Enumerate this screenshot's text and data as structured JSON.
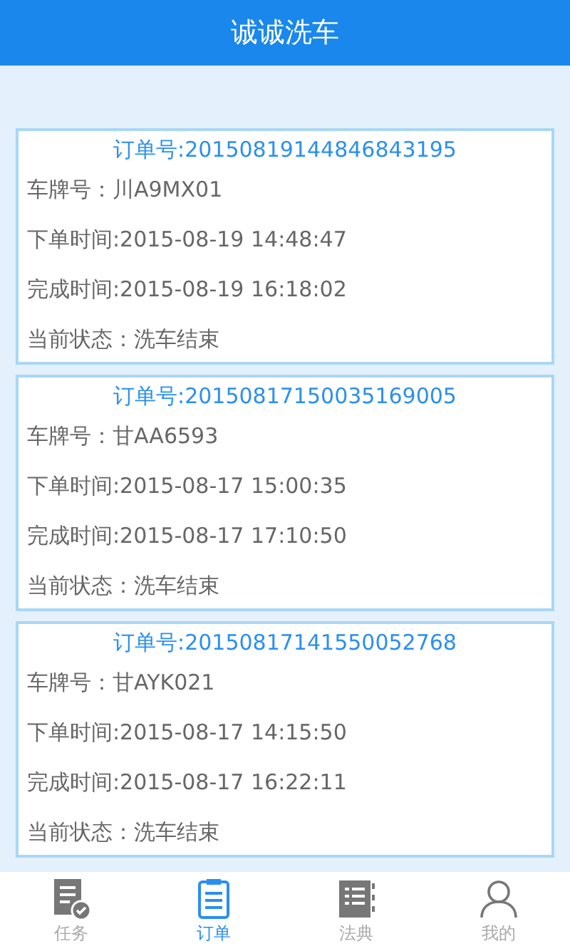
{
  "title": "诚诚洗车",
  "orders": [
    {
      "order_no": "订单号:20150819144846843195",
      "plate": "车牌号：川A9MX01",
      "ordered": "下单时间:2015-08-19 14:48:47",
      "completed": "完成时间:2015-08-19 16:18:02",
      "status": "当前状态：洗车结束"
    },
    {
      "order_no": "订单号:20150817150035169005",
      "plate": "车牌号：甘AA6593",
      "ordered": "下单时间:2015-08-17 15:00:35",
      "completed": "完成时间:2015-08-17 17:10:50",
      "status": "当前状态：洗车结束"
    },
    {
      "order_no": "订单号:20150817141550052768",
      "plate": "车牌号：甘AYK021",
      "ordered": "下单时间:2015-08-17 14:15:50",
      "completed": "完成时间:2015-08-17 16:22:11",
      "status": "当前状态：洗车结束"
    }
  ],
  "tabs": [
    {
      "kind": "task",
      "label": "任务",
      "selected": false
    },
    {
      "kind": "order",
      "label": "订单",
      "selected": true
    },
    {
      "kind": "law",
      "label": "法典",
      "selected": false
    },
    {
      "kind": "me",
      "label": "我的",
      "selected": false
    }
  ]
}
